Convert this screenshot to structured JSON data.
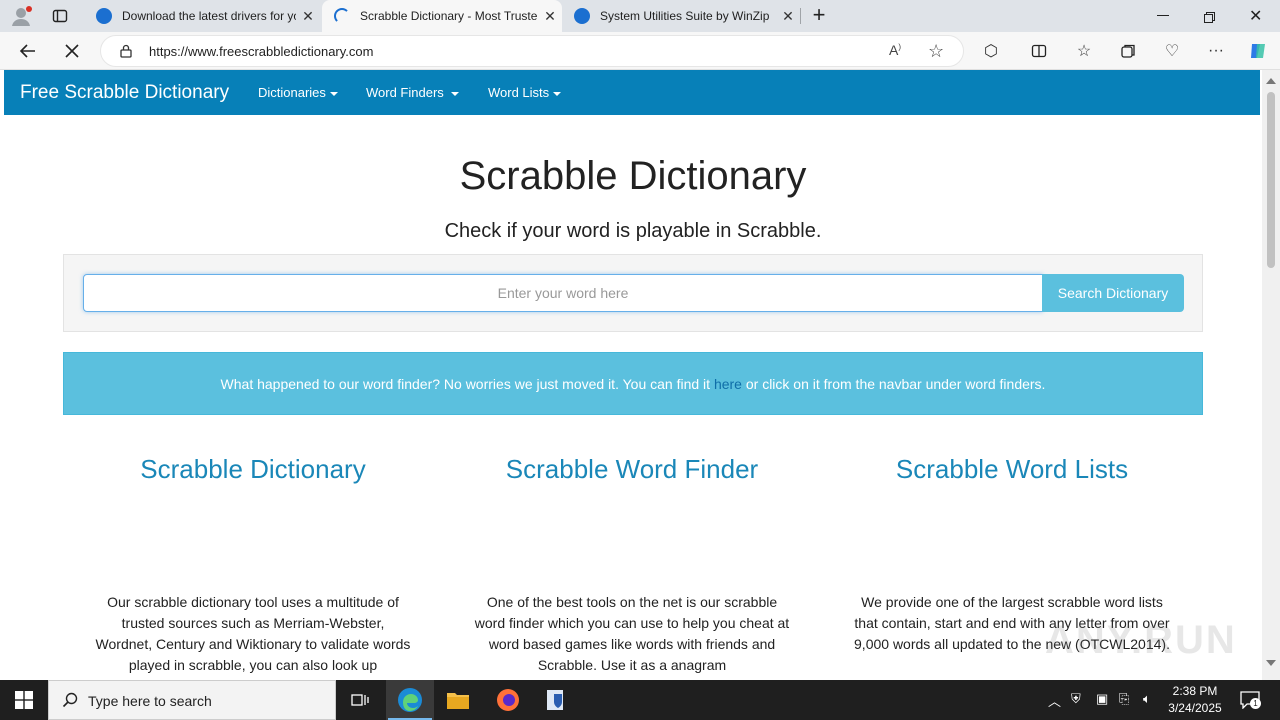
{
  "browser": {
    "tabs": [
      {
        "title": "Download the latest drivers for yo",
        "active": false
      },
      {
        "title": "Scrabble Dictionary - Most Truste",
        "active": true
      },
      {
        "title": "System Utilities Suite by WinZip",
        "active": false
      }
    ],
    "url": "https://www.freescrabbledictionary.com",
    "url_host": "www.freescrabbledictionary.com"
  },
  "site": {
    "brand": "Free Scrabble Dictionary",
    "nav": [
      "Dictionaries",
      "Word Finders",
      "Word Lists"
    ],
    "heading": "Scrabble Dictionary",
    "subheading": "Check if your word is playable in Scrabble.",
    "search": {
      "placeholder": "Enter your word here",
      "value": "",
      "button": "Search Dictionary"
    },
    "alert": {
      "before": "What happened to our word finder? No worries we just moved it. You can find it ",
      "link": "here",
      "after": " or click on it from the navbar under word finders."
    },
    "columns": [
      {
        "title": "Scrabble Dictionary",
        "text": "Our scrabble dictionary tool uses a multitude of trusted sources such as Merriam-Webster, Wordnet, Century and Wiktionary to validate words played in scrabble, you can also look up"
      },
      {
        "title": "Scrabble Word Finder",
        "text": "One of the best tools on the net is our scrabble word finder which you can use to help you cheat at word based games like words with friends and Scrabble. Use it as a anagram"
      },
      {
        "title": "Scrabble Word Lists",
        "text": "We provide one of the largest scrabble word lists that contain, start and end with any letter from over 9,000 words all updated to the new (OTCWL2014)."
      }
    ]
  },
  "watermark": "ANY.RUN",
  "taskbar": {
    "search_placeholder": "Type here to search",
    "time": "2:38 PM",
    "date": "3/24/2025",
    "notification_count": "1"
  },
  "colors": {
    "navbar": "#0780b8",
    "accent_link": "#1a87b8",
    "info": "#5bc0de"
  }
}
